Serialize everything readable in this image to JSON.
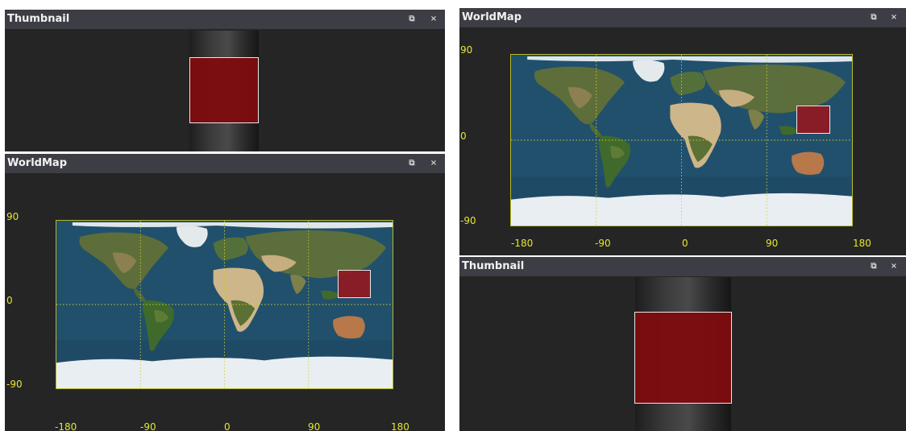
{
  "left_dock": {
    "thumbnail_panel": {
      "title": "Thumbnail"
    },
    "worldmap_panel": {
      "title": "WorldMap",
      "y_ticks": [
        "90",
        "0",
        "-90"
      ],
      "x_ticks": [
        "-180",
        "-90",
        "0",
        "90",
        "180"
      ]
    }
  },
  "right_dock": {
    "worldmap_panel": {
      "title": "WorldMap",
      "y_ticks": [
        "90",
        "0",
        "-90"
      ],
      "x_ticks": [
        "-180",
        "-90",
        "0",
        "90",
        "180"
      ]
    },
    "thumbnail_panel": {
      "title": "Thumbnail"
    }
  },
  "buttons": {
    "float": "⧉",
    "close": "×"
  },
  "colors": {
    "titlebar": "#3d3d45",
    "panel_bg": "#252526",
    "axis_label": "#e6e62c",
    "selection": "#961421"
  },
  "icons": [
    "float-window-icon",
    "close-icon"
  ]
}
